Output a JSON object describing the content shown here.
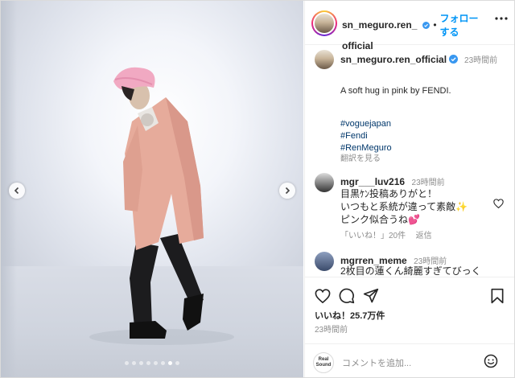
{
  "post": {
    "username": "sn_meguro.ren_official",
    "header_username_line1": "sn_meguro.ren_",
    "header_username_line2": "official",
    "follow_sep": "•",
    "follow_label": "フォローする",
    "more_icon": "more-horizontal-icon",
    "caption": {
      "time": "23時間前",
      "text": "A soft hug in pink by FENDI.",
      "hashtags": [
        "#voguejapan",
        "#Fendi",
        "#RenMeguro"
      ],
      "translate": "翻訳を見る"
    },
    "carousel": {
      "slides": 8,
      "current_index": 6
    },
    "comments": [
      {
        "username": "mgr___luv216",
        "time": "23時間前",
        "lines": [
          "目黒ｹﾝ投稿ありがと！",
          "いつもと系統が違って素敵✨",
          "ピンク似合うね💕"
        ],
        "likes": "「いいね！」20件",
        "reply": "返信"
      },
      {
        "username": "mgrren_meme",
        "time": "23時間前",
        "lines": [
          "2枚目の蓮くん綺麗すぎてびっく"
        ]
      }
    ],
    "likes_count": "いいね！25.7万件",
    "posted_time": "23時間前",
    "comment_placeholder": "コメントを追加...",
    "commenter_avatar_text": "Real Sound"
  },
  "colors": {
    "accent": "#0095f6",
    "verified": "#3897f0",
    "hashtag": "#00376b",
    "coat": "#e6ab9b",
    "hat": "#f1a9c2"
  }
}
